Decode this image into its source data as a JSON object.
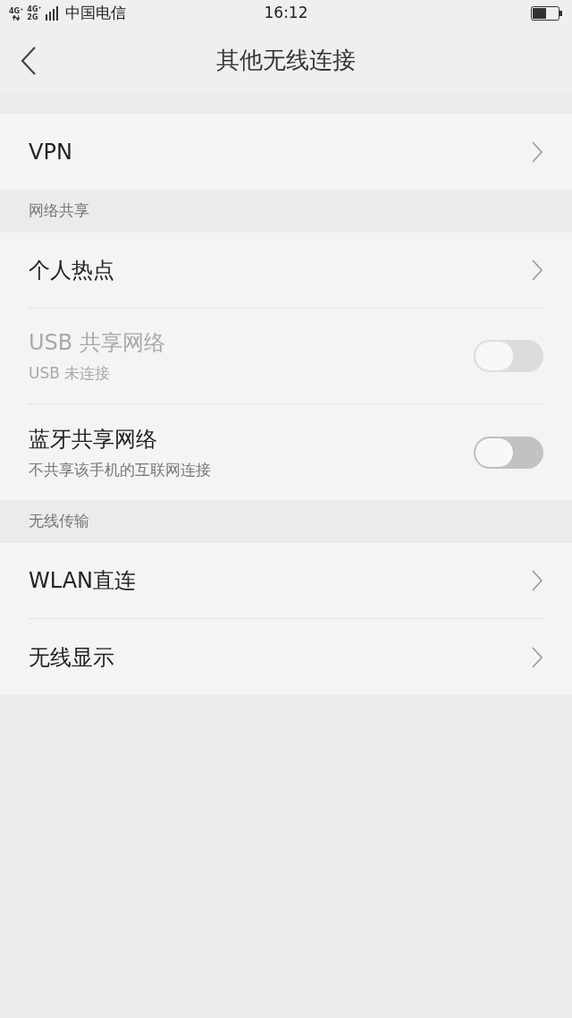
{
  "status_bar": {
    "network_labels": [
      "4G⁺",
      "4G⁺",
      "2G"
    ],
    "carrier": "中国电信",
    "time": "16:12"
  },
  "header": {
    "title": "其他无线连接"
  },
  "sections": [
    {
      "items": [
        {
          "kind": "link",
          "label": "VPN"
        }
      ]
    },
    {
      "heading": "网络共享",
      "items": [
        {
          "kind": "link",
          "label": "个人热点"
        },
        {
          "kind": "toggle",
          "label": "USB 共享网络",
          "subtitle": "USB 未连接",
          "on": false,
          "disabled": true
        },
        {
          "kind": "toggle",
          "label": "蓝牙共享网络",
          "subtitle": "不共享该手机的互联网连接",
          "on": false,
          "disabled": false
        }
      ]
    },
    {
      "heading": "无线传输",
      "items": [
        {
          "kind": "link",
          "label": "WLAN直连"
        },
        {
          "kind": "link",
          "label": "无线显示"
        }
      ]
    }
  ]
}
